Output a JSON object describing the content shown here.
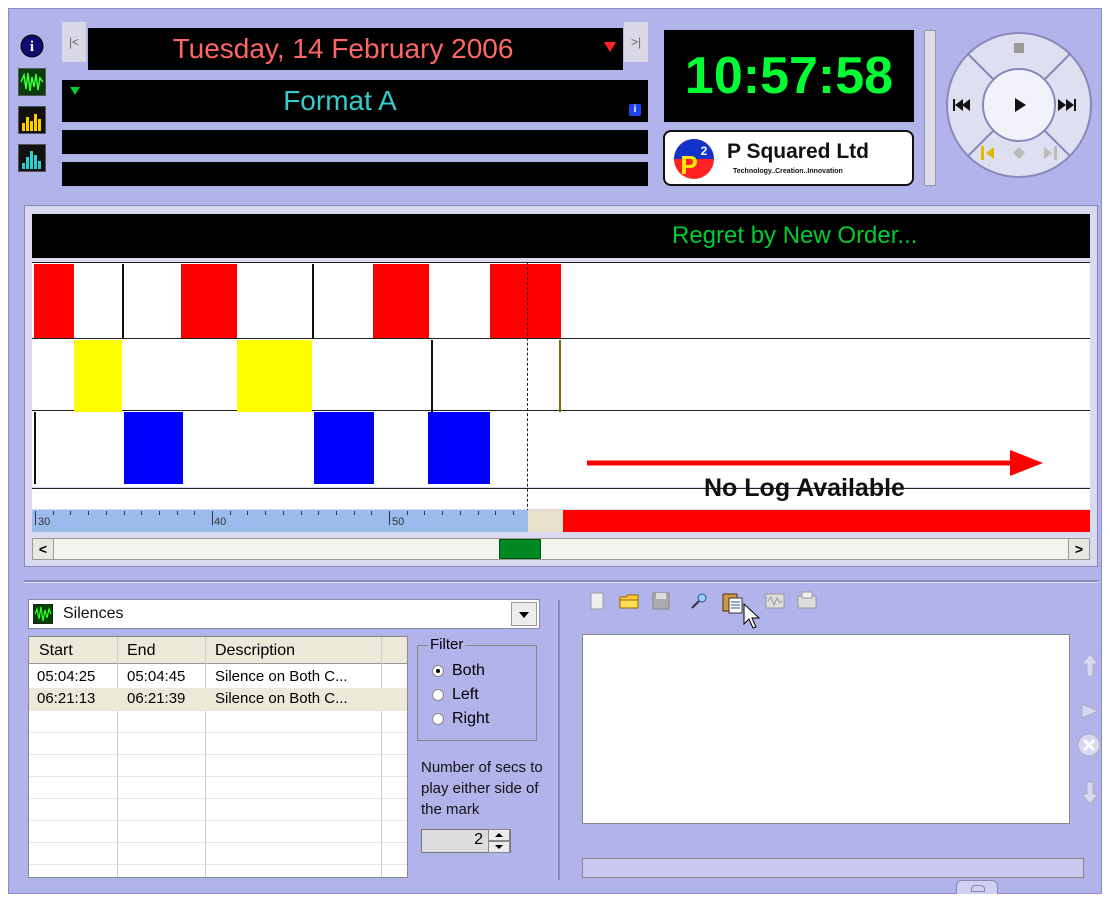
{
  "header": {
    "date": "Tuesday, 14 February 2006",
    "format": "Format A",
    "clock": "10:57:58",
    "logo_name": "P Squared Ltd",
    "logo_tagline": "Technology..Creation..Innovation",
    "logo_mark": "P2"
  },
  "timeline": {
    "now_playing": "Regret by New Order...",
    "no_log_text": "No Log Available",
    "ruler_labels": [
      "30",
      "40",
      "50"
    ]
  },
  "silences": {
    "dropdown_label": "Silences",
    "columns": [
      "Start",
      "End",
      "Description"
    ],
    "rows": [
      {
        "start": "05:04:25",
        "end": "05:04:45",
        "description": "Silence on Both C..."
      },
      {
        "start": "06:21:13",
        "end": "06:21:39",
        "description": "Silence on Both C..."
      }
    ]
  },
  "filter": {
    "title": "Filter",
    "options": [
      "Both",
      "Left",
      "Right"
    ],
    "selected": "Both",
    "secs_label": "Number of secs to play either side of the mark",
    "secs_value": "2"
  },
  "colors": {
    "red": "#ff0000",
    "yellow": "#ffff00",
    "blue": "#0000ff",
    "bg": "#b3b3ec",
    "green": "#00ff33",
    "cyan": "#33cccc"
  }
}
